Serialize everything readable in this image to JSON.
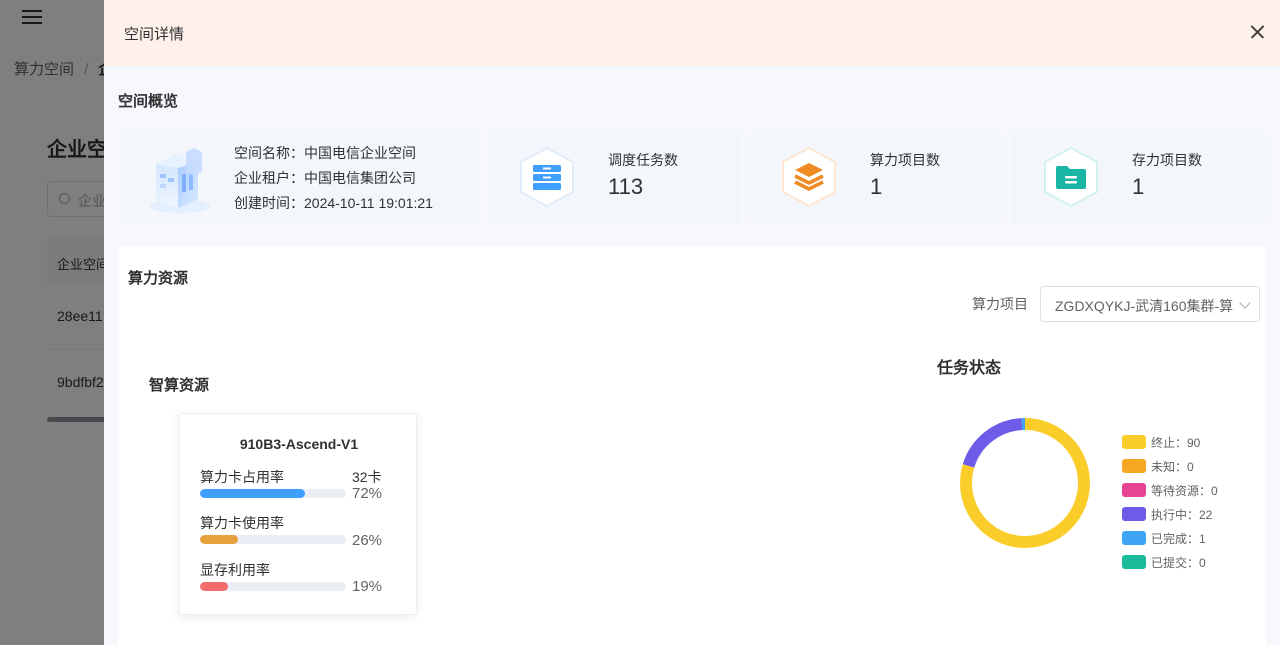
{
  "background": {
    "breadcrumb": {
      "root": "算力空间",
      "separator": "/",
      "current": "企业"
    },
    "page_title": "企业空",
    "search_placeholder": "企业",
    "table": {
      "header": "企业空间",
      "rows": [
        "28ee11",
        "9bdfbf2"
      ]
    }
  },
  "drawer": {
    "title": "空间详情",
    "overview": {
      "section_title": "空间概览",
      "info": {
        "name_label": "空间名称：",
        "name_value": "中国电信企业空间",
        "tenant_label": "企业租户：",
        "tenant_value": "中国电信集团公司",
        "created_label": "创建时间：",
        "created_value": "2024-10-11 19:01:21"
      },
      "stats": [
        {
          "label": "调度任务数",
          "value": "113",
          "icon": "server-icon",
          "color": "#409eff"
        },
        {
          "label": "算力项目数",
          "value": "1",
          "icon": "layers-icon",
          "color": "#f08a24"
        },
        {
          "label": "存力项目数",
          "value": "1",
          "icon": "folder-icon",
          "color": "#19b5a5"
        }
      ]
    },
    "compute": {
      "section_title": "算力资源",
      "project_label": "算力项目",
      "project_value": "ZGDXQYKJ-武清160集群-算",
      "smart_title": "智算资源",
      "card": {
        "name": "910B3-Ascend-V1",
        "metrics": [
          {
            "label": "算力卡占用率",
            "cards": "32卡",
            "percent_text": "72%",
            "value": 0.72,
            "color": "#409eff"
          },
          {
            "label": "算力卡使用率",
            "cards": "",
            "percent_text": "26%",
            "value": 0.26,
            "color": "#e6a23c"
          },
          {
            "label": "显存利用率",
            "cards": "",
            "percent_text": "19%",
            "value": 0.19,
            "color": "#f56c6c"
          }
        ]
      },
      "task_chart_title": "任务状态"
    }
  },
  "chart_data": {
    "type": "pie",
    "title": "任务状态",
    "donut": true,
    "series": [
      {
        "name": "终止",
        "value": 90,
        "label": "终止：90",
        "color": "#fbcd2b"
      },
      {
        "name": "未知",
        "value": 0,
        "label": "未知：0",
        "color": "#f5a623"
      },
      {
        "name": "等待资源",
        "value": 0,
        "label": "等待资源：0",
        "color": "#e84393"
      },
      {
        "name": "执行中",
        "value": 22,
        "label": "执行中：22",
        "color": "#6c5ce7"
      },
      {
        "name": "已完成",
        "value": 1,
        "label": "已完成：1",
        "color": "#3da5f4"
      },
      {
        "name": "已提交",
        "value": 0,
        "label": "已提交：0",
        "color": "#1abc9c"
      }
    ],
    "legend_position": "right"
  }
}
